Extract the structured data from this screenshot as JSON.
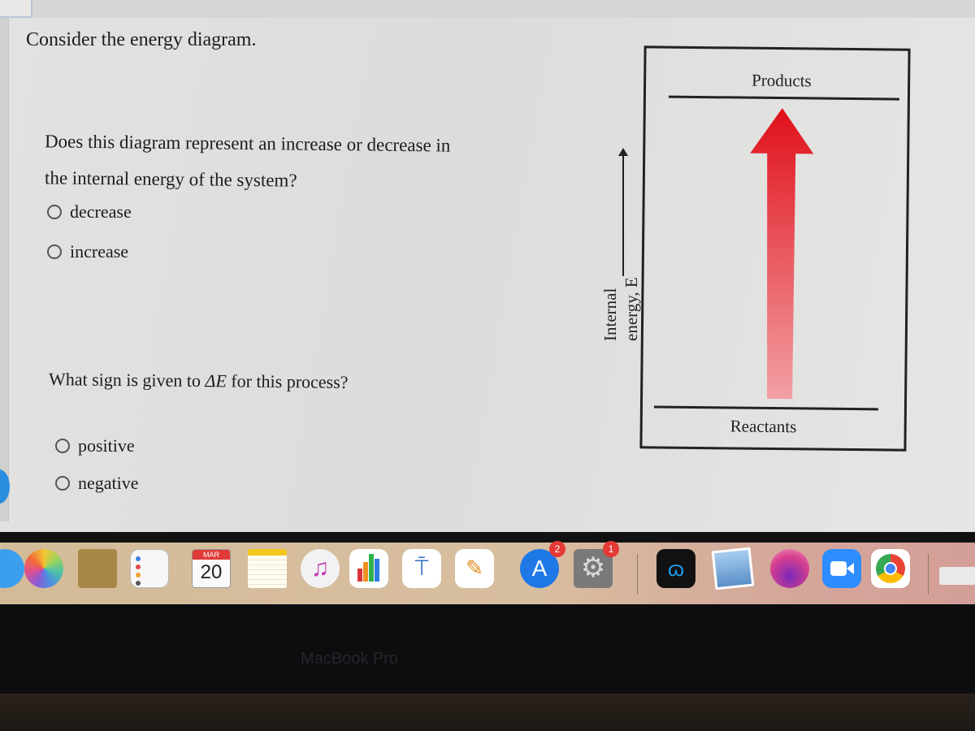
{
  "question": {
    "intro": "Consider the energy diagram.",
    "q1_line1": "Does this diagram represent an increase or decrease in",
    "q1_line2": "the internal energy of the system?",
    "q1_options": [
      "decrease",
      "increase"
    ],
    "q2_prefix": "What sign is given to ",
    "q2_symbol": "ΔE",
    "q2_suffix": " for this process?",
    "q2_options": [
      "positive",
      "negative"
    ]
  },
  "diagram": {
    "axis_label_line1": "Internal",
    "axis_label_line2": "energy, E",
    "top_level_label": "Products",
    "bottom_level_label": "Reactants",
    "arrow_direction": "up",
    "arrow_color_top": "#e0101a",
    "arrow_color_bottom": "#f2a0a4"
  },
  "dock": {
    "calendar_month": "MAR",
    "calendar_day": "20",
    "apps": [
      {
        "name": "Messages"
      },
      {
        "name": "Photos"
      },
      {
        "name": "Contacts"
      },
      {
        "name": "Reminders"
      },
      {
        "name": "Calendar"
      },
      {
        "name": "Notes"
      },
      {
        "name": "Music"
      },
      {
        "name": "Numbers"
      },
      {
        "name": "Keynote"
      },
      {
        "name": "Pages"
      },
      {
        "name": "App Store",
        "badge": "2"
      },
      {
        "name": "System Preferences",
        "badge": "1"
      },
      {
        "name": "Webex"
      },
      {
        "name": "Preview"
      },
      {
        "name": "macOS Installer"
      },
      {
        "name": "Zoom"
      },
      {
        "name": "Chrome"
      }
    ]
  },
  "device": {
    "brand": "MacBook Pro"
  }
}
